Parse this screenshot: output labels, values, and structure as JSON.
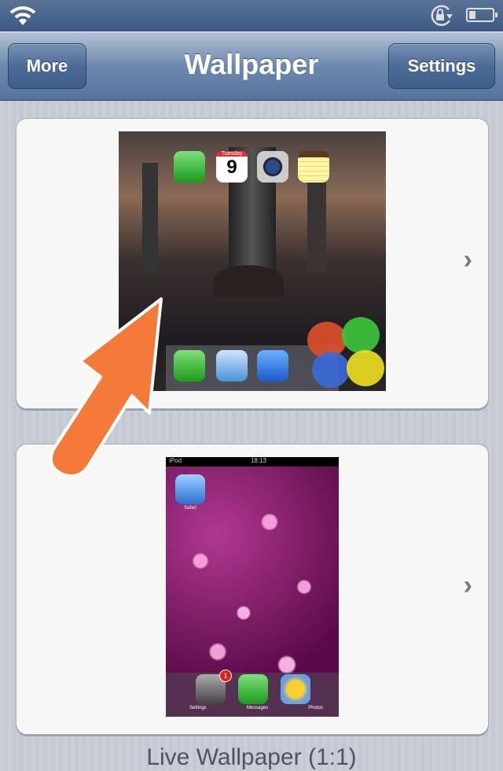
{
  "status_bar": {
    "icons": [
      "wifi-icon",
      "rotation-lock-icon",
      "battery-icon"
    ]
  },
  "nav": {
    "title": "Wallpaper",
    "left_button": "More",
    "right_button": "Settings"
  },
  "wallpapers": [
    {
      "calendar_day": "Tuesday",
      "calendar_date": "9"
    },
    {
      "carrier": "iPod",
      "time": "18:13",
      "badge": "1",
      "labels": [
        "Safari",
        "Settings",
        "Messages",
        "Photos"
      ]
    }
  ],
  "footer": {
    "label": "Live Wallpaper (1:1)"
  },
  "colors": {
    "arrow": "#f47a3a",
    "nav": "#5a7aa3"
  }
}
